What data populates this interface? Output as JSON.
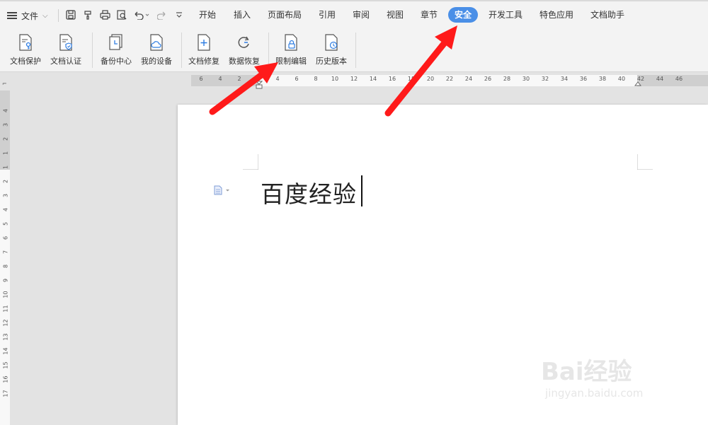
{
  "menubar": {
    "file_label": "文件",
    "tabs": [
      "开始",
      "插入",
      "页面布局",
      "引用",
      "审阅",
      "视图",
      "章节",
      "安全",
      "开发工具",
      "特色应用",
      "文档助手"
    ],
    "active_tab": "安全"
  },
  "ribbon": {
    "buttons": [
      {
        "label": "文档保护",
        "icon": "document-key-icon"
      },
      {
        "label": "文档认证",
        "icon": "document-shield-icon"
      },
      {
        "label": "备份中心",
        "icon": "backup-icon"
      },
      {
        "label": "我的设备",
        "icon": "cloud-document-icon"
      },
      {
        "label": "文档修复",
        "icon": "document-plus-icon"
      },
      {
        "label": "数据恢复",
        "icon": "restore-icon"
      },
      {
        "label": "限制编辑",
        "icon": "document-lock-icon"
      },
      {
        "label": "历史版本",
        "icon": "document-clock-icon"
      }
    ]
  },
  "ruler": {
    "h_ticks": [
      "6",
      "4",
      "2",
      "2",
      "4",
      "6",
      "8",
      "10",
      "12",
      "14",
      "16",
      "18",
      "20",
      "22",
      "24",
      "26",
      "28",
      "30",
      "32",
      "34",
      "36",
      "38",
      "40",
      "42",
      "44",
      "46"
    ],
    "v_ticks": [
      "4",
      "3",
      "2",
      "1",
      "1",
      "2",
      "3",
      "4",
      "5",
      "6",
      "7",
      "8",
      "9",
      "10",
      "11",
      "12",
      "13",
      "14",
      "15",
      "16",
      "17"
    ]
  },
  "document": {
    "text": "百度经验"
  },
  "watermark": {
    "brand": "Bai经验",
    "url": "jingyan.baidu.com"
  },
  "colors": {
    "accent": "#4a8fe7",
    "arrow": "#ff1a1a"
  }
}
